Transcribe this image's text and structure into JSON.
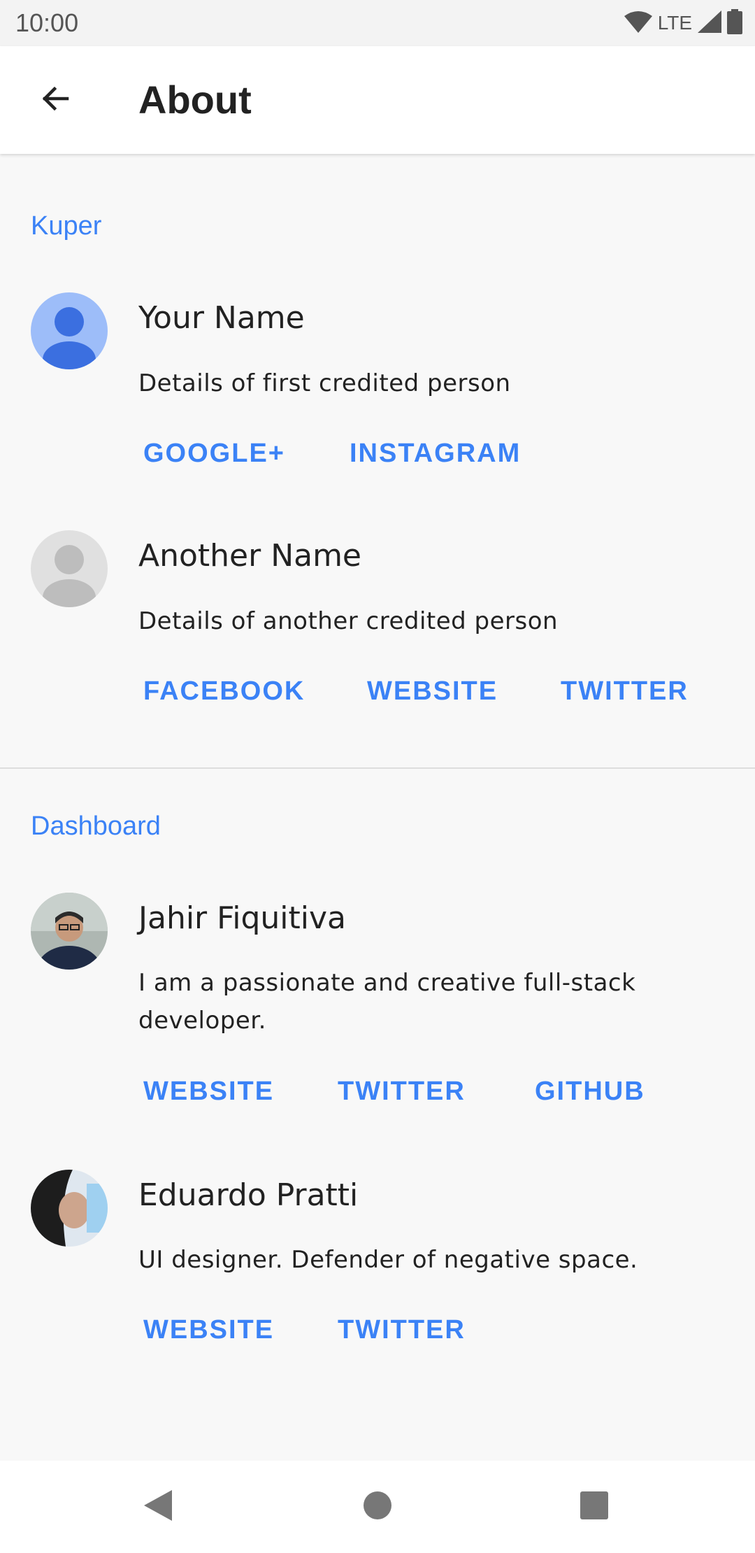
{
  "status_bar": {
    "time": "10:00",
    "network": "LTE"
  },
  "app_bar": {
    "title": "About"
  },
  "sections": [
    {
      "header": "Kuper",
      "people": [
        {
          "name": "Your Name",
          "description": "Details of first credited person",
          "links": [
            "GOOGLE+",
            "INSTAGRAM"
          ]
        },
        {
          "name": "Another Name",
          "description": "Details of another credited person",
          "links": [
            "FACEBOOK",
            "WEBSITE",
            "TWITTER"
          ]
        }
      ]
    },
    {
      "header": "Dashboard",
      "people": [
        {
          "name": "Jahir Fiquitiva",
          "description": "I am a passionate and creative full-stack developer.",
          "links": [
            "WEBSITE",
            "TWITTER",
            "GITHUB"
          ]
        },
        {
          "name": "Eduardo Pratti",
          "description": "UI designer. Defender of negative space.",
          "links": [
            "WEBSITE",
            "TWITTER"
          ]
        }
      ]
    }
  ],
  "colors": {
    "accent": "#3b82f6",
    "avatar_primary": "#3b6fe0",
    "avatar_secondary": "#9dbdf9"
  }
}
